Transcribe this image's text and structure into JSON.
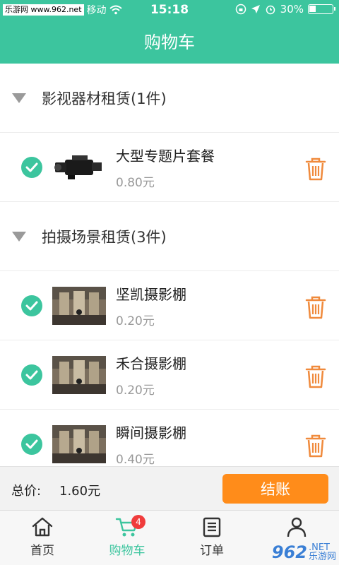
{
  "status": {
    "watermark": "乐游网 www.962.net",
    "carrier": "移动",
    "time": "15:18",
    "battery": "30%",
    "battery_level": 0.3
  },
  "nav": {
    "title": "购物车"
  },
  "groups": [
    {
      "title": "影视器材租赁(1件)",
      "items": [
        {
          "name": "大型专题片套餐",
          "price": "0.80元"
        }
      ]
    },
    {
      "title": "拍摄场景租赁(3件)",
      "items": [
        {
          "name": "坚凯摄影棚",
          "price": "0.20元"
        },
        {
          "name": "禾合摄影棚",
          "price": "0.20元"
        },
        {
          "name": "瞬间摄影棚",
          "price": "0.40元"
        }
      ]
    }
  ],
  "footer": {
    "total_label": "总价:",
    "total_value": "1.60元",
    "checkout_label": "结账"
  },
  "tabbar": {
    "home": "首页",
    "cart": "购物车",
    "cart_badge": "4",
    "orders": "订单"
  },
  "logo": {
    "main": "962",
    "sub": ".NET",
    "sub2": "乐游网"
  },
  "colors": {
    "accent": "#3cc59e",
    "checkout": "#ff8c1a",
    "trash": "#f08a3c",
    "badge": "#f03c3c"
  },
  "icons": {
    "wifi": "wifi-icon",
    "check": "check-circle-icon",
    "trash": "trash-icon",
    "home": "home-icon",
    "cart": "cart-icon",
    "orders": "orders-icon",
    "user": "user-icon"
  }
}
